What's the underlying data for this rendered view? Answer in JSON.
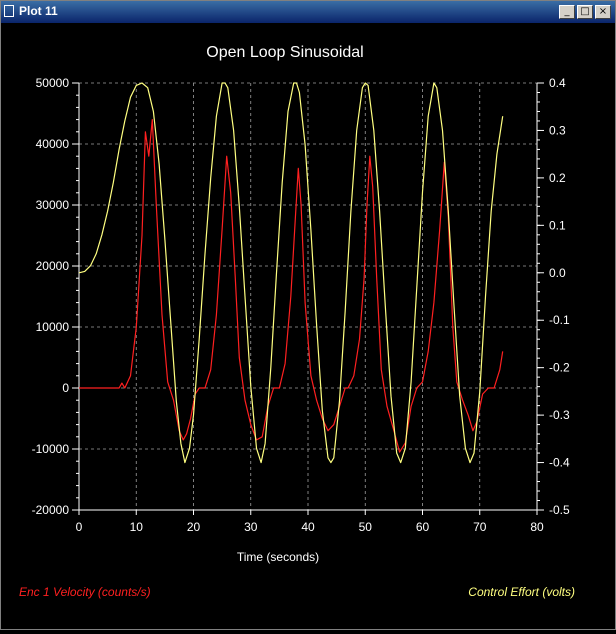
{
  "window": {
    "title": "Plot 11",
    "minimize_glyph": "_",
    "maximize_glyph": "□",
    "close_glyph": "×"
  },
  "chart_data": {
    "type": "line",
    "title": "Open Loop Sinusoidal",
    "xlabel": "Time (seconds)",
    "xlim": [
      0,
      80
    ],
    "xticks": [
      0,
      10,
      20,
      30,
      40,
      50,
      60,
      70,
      80
    ],
    "y_left": {
      "label": "Enc 1 Velocity (counts/s)",
      "lim": [
        -20000,
        50000
      ],
      "ticks": [
        -20000,
        -10000,
        0,
        10000,
        20000,
        30000,
        40000,
        50000
      ]
    },
    "y_right": {
      "label": "Control Effort (volts)",
      "lim": [
        -0.5,
        0.4
      ],
      "ticks": [
        -0.5,
        -0.4,
        -0.3,
        -0.2,
        -0.1,
        0.0,
        0.1,
        0.2,
        0.3,
        0.4
      ],
      "tick_labels": [
        "-0.5",
        "-0.4",
        "-0.3",
        "-0.2",
        "-0.1",
        "0.0",
        "0.1",
        "0.2",
        "0.3",
        "0.4"
      ]
    },
    "grid": true,
    "colors": {
      "background": "#000000",
      "axes": "#ffffff",
      "grid": "#a0a0a0",
      "velocity": "#ff2020",
      "effort": "#ffff80"
    },
    "series": [
      {
        "name": "Enc 1 Velocity (counts/s)",
        "axis": "left",
        "color": "#ff2020",
        "points": [
          [
            0,
            0
          ],
          [
            7,
            0
          ],
          [
            7.5,
            800
          ],
          [
            8,
            0
          ],
          [
            9,
            2000
          ],
          [
            10,
            10000
          ],
          [
            11,
            25000
          ],
          [
            11.6,
            42000
          ],
          [
            12.2,
            38000
          ],
          [
            12.8,
            44000
          ],
          [
            13.5,
            30000
          ],
          [
            14.5,
            12000
          ],
          [
            15.5,
            1000
          ],
          [
            16.5,
            -2000
          ],
          [
            17.5,
            -7000
          ],
          [
            18.2,
            -8500
          ],
          [
            18.8,
            -7500
          ],
          [
            19.5,
            -5000
          ],
          [
            20.3,
            -1000
          ],
          [
            21,
            0
          ],
          [
            22,
            0
          ],
          [
            23,
            3000
          ],
          [
            24,
            12000
          ],
          [
            25,
            26000
          ],
          [
            25.8,
            38000
          ],
          [
            26.5,
            32000
          ],
          [
            27.3,
            18000
          ],
          [
            28,
            5000
          ],
          [
            29,
            -2000
          ],
          [
            30,
            -6000
          ],
          [
            31,
            -8500
          ],
          [
            32,
            -8000
          ],
          [
            33,
            -3000
          ],
          [
            34,
            0
          ],
          [
            35,
            0
          ],
          [
            36,
            4000
          ],
          [
            37,
            15000
          ],
          [
            37.8,
            28000
          ],
          [
            38.3,
            36000
          ],
          [
            38.8,
            30000
          ],
          [
            39.5,
            14000
          ],
          [
            40.5,
            2000
          ],
          [
            41.5,
            -2000
          ],
          [
            42.5,
            -5000
          ],
          [
            43.5,
            -7000
          ],
          [
            44.5,
            -6000
          ],
          [
            45.5,
            -3000
          ],
          [
            46.5,
            0
          ],
          [
            47,
            0
          ],
          [
            48,
            2000
          ],
          [
            49,
            8000
          ],
          [
            49.8,
            18000
          ],
          [
            50.3,
            30000
          ],
          [
            50.8,
            38000
          ],
          [
            51.3,
            33000
          ],
          [
            52,
            18000
          ],
          [
            52.8,
            3000
          ],
          [
            53.8,
            -3000
          ],
          [
            55,
            -7000
          ],
          [
            56,
            -10500
          ],
          [
            57,
            -9000
          ],
          [
            58,
            -3000
          ],
          [
            59,
            0
          ],
          [
            60,
            1000
          ],
          [
            61,
            6000
          ],
          [
            62,
            14000
          ],
          [
            63,
            26000
          ],
          [
            63.8,
            37000
          ],
          [
            64.5,
            28000
          ],
          [
            65.3,
            10000
          ],
          [
            66,
            1000
          ],
          [
            67,
            -2000
          ],
          [
            68,
            -4500
          ],
          [
            68.8,
            -7000
          ],
          [
            69.5,
            -5500
          ],
          [
            70.5,
            -1000
          ],
          [
            71.5,
            0
          ],
          [
            72.5,
            0
          ],
          [
            73.5,
            3000
          ],
          [
            74,
            6000
          ]
        ]
      },
      {
        "name": "Control Effort (volts)",
        "axis": "right",
        "color": "#ffff80",
        "points": [
          [
            0,
            0.0
          ],
          [
            1,
            0.003
          ],
          [
            2,
            0.015
          ],
          [
            3,
            0.04
          ],
          [
            4,
            0.08
          ],
          [
            5,
            0.13
          ],
          [
            6,
            0.19
          ],
          [
            7,
            0.26
          ],
          [
            8,
            0.32
          ],
          [
            9,
            0.37
          ],
          [
            10,
            0.395
          ],
          [
            11,
            0.4
          ],
          [
            12,
            0.39
          ],
          [
            13,
            0.34
          ],
          [
            14,
            0.23
          ],
          [
            15,
            0.07
          ],
          [
            16,
            -0.1
          ],
          [
            17,
            -0.27
          ],
          [
            17.8,
            -0.36
          ],
          [
            18.5,
            -0.4
          ],
          [
            19.3,
            -0.37
          ],
          [
            20,
            -0.3
          ],
          [
            21,
            -0.14
          ],
          [
            22,
            0.04
          ],
          [
            23,
            0.2
          ],
          [
            24,
            0.33
          ],
          [
            25,
            0.4
          ],
          [
            25.5,
            0.4
          ],
          [
            26,
            0.39
          ],
          [
            27,
            0.3
          ],
          [
            28,
            0.14
          ],
          [
            29,
            -0.05
          ],
          [
            30,
            -0.24
          ],
          [
            31,
            -0.37
          ],
          [
            31.8,
            -0.4
          ],
          [
            32.5,
            -0.36
          ],
          [
            33.5,
            -0.2
          ],
          [
            34.5,
            0.0
          ],
          [
            35.5,
            0.19
          ],
          [
            36.5,
            0.34
          ],
          [
            37.5,
            0.4
          ],
          [
            38,
            0.4
          ],
          [
            38.5,
            0.38
          ],
          [
            39.5,
            0.27
          ],
          [
            40.5,
            0.09
          ],
          [
            41.5,
            -0.11
          ],
          [
            42.5,
            -0.29
          ],
          [
            43.5,
            -0.39
          ],
          [
            44,
            -0.4
          ],
          [
            44.5,
            -0.39
          ],
          [
            45.5,
            -0.27
          ],
          [
            46.5,
            -0.08
          ],
          [
            47.5,
            0.13
          ],
          [
            48.5,
            0.3
          ],
          [
            49.5,
            0.39
          ],
          [
            50,
            0.4
          ],
          [
            50.5,
            0.395
          ],
          [
            51.5,
            0.3
          ],
          [
            52.5,
            0.13
          ],
          [
            53.5,
            -0.07
          ],
          [
            54.5,
            -0.26
          ],
          [
            55.5,
            -0.38
          ],
          [
            56.2,
            -0.4
          ],
          [
            57,
            -0.37
          ],
          [
            58,
            -0.23
          ],
          [
            59,
            -0.03
          ],
          [
            60,
            0.17
          ],
          [
            61,
            0.33
          ],
          [
            62,
            0.4
          ],
          [
            62.5,
            0.39
          ],
          [
            63.5,
            0.3
          ],
          [
            64.5,
            0.13
          ],
          [
            65.5,
            -0.07
          ],
          [
            66.5,
            -0.26
          ],
          [
            67.5,
            -0.37
          ],
          [
            68.3,
            -0.4
          ],
          [
            69,
            -0.38
          ],
          [
            70,
            -0.25
          ],
          [
            71,
            -0.05
          ],
          [
            72,
            0.13
          ],
          [
            73,
            0.25
          ],
          [
            74,
            0.33
          ]
        ]
      }
    ],
    "legend": {
      "left": "Enc 1 Velocity (counts/s)",
      "right": "Control Effort (volts)"
    }
  }
}
